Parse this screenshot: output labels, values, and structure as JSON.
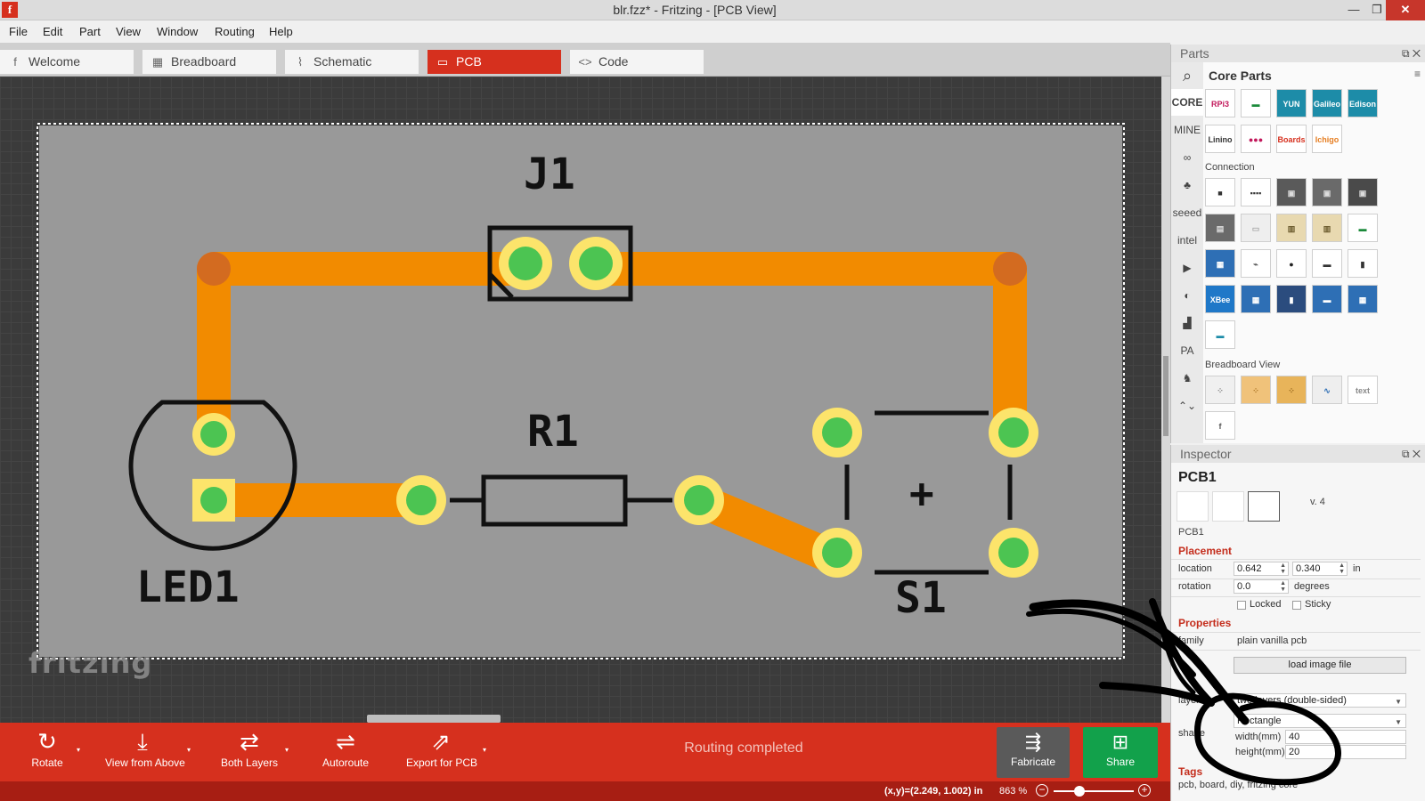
{
  "window": {
    "app_icon": "f",
    "title": "blr.fzz* - Fritzing - [PCB View]",
    "controls": {
      "minimize": "—",
      "maximize": "❐",
      "close": "✕"
    }
  },
  "menu": [
    "File",
    "Edit",
    "Part",
    "View",
    "Window",
    "Routing",
    "Help"
  ],
  "tabs": [
    {
      "label": "Welcome",
      "icon": "f"
    },
    {
      "label": "Breadboard",
      "icon": "▦"
    },
    {
      "label": "Schematic",
      "icon": "⌇"
    },
    {
      "label": "PCB",
      "icon": "▭"
    },
    {
      "label": "Code",
      "icon": "<>"
    }
  ],
  "active_tab": "PCB",
  "pcb": {
    "labels": {
      "j1": "J1",
      "r1": "R1",
      "led1": "LED1",
      "s1": "S1",
      "plus": "+"
    },
    "watermark": "fritzing",
    "colors": {
      "board": "#999999",
      "trace": "#f28b00",
      "pad_ring": "#fce46b",
      "pad_center": "#4cc452",
      "silk": "#111111",
      "canvas": "#3b3b3b"
    }
  },
  "toolbar": {
    "rotate": "Rotate",
    "view_from_above": "View from Above",
    "both_layers": "Both Layers",
    "autoroute": "Autoroute",
    "export_for_pcb": "Export for PCB",
    "status": "Routing completed",
    "fabricate": "Fabricate",
    "share": "Share"
  },
  "statusbar": {
    "coords": "(x,y)=(2.249, 1.002) in",
    "zoom": "863 %",
    "zoom_out": "−",
    "zoom_in": "+"
  },
  "parts": {
    "title": "Parts",
    "panel_buttons": "⧉ ✕",
    "bin_title": "Core Parts",
    "bin_menu": "≡",
    "bins": [
      {
        "label": "CORE",
        "active": true
      },
      {
        "label": "MINE",
        "active": false
      },
      {
        "label": "∞",
        "active": false
      },
      {
        "label": "♣",
        "active": false
      },
      {
        "label": "seeed",
        "active": false
      },
      {
        "label": "intel",
        "active": false
      },
      {
        "label": "▶",
        "active": false
      },
      {
        "label": "◐",
        "active": false
      },
      {
        "label": "▟",
        "active": false
      },
      {
        "label": "PA",
        "active": false
      },
      {
        "label": "♞",
        "active": false
      },
      {
        "label": "⌃⌄",
        "active": false
      }
    ],
    "sections": {
      "connection": "Connection",
      "breadboard_view": "Breadboard View"
    },
    "tiles_row1": [
      {
        "text": "RPi3",
        "bg": "#ffffff",
        "fg": "#c2185b"
      },
      {
        "text": "▬",
        "bg": "#ffffff",
        "fg": "#1b8a3a"
      },
      {
        "text": "YUN",
        "bg": "#1d8ca8",
        "fg": "#ffffff"
      },
      {
        "text": "Galileo",
        "bg": "#1d8ca8",
        "fg": "#ffffff"
      },
      {
        "text": "Edison",
        "bg": "#1d8ca8",
        "fg": "#ffffff"
      }
    ],
    "tiles_row2": [
      {
        "text": "Linino",
        "bg": "#ffffff",
        "fg": "#333333"
      },
      {
        "text": "●●●",
        "bg": "#ffffff",
        "fg": "#c2185b"
      },
      {
        "text": "Boards",
        "bg": "#ffffff",
        "fg": "#d6301e"
      },
      {
        "text": "Ichigo",
        "bg": "#ffffff",
        "fg": "#e67e22"
      }
    ],
    "connection_tiles": [
      {
        "text": "■",
        "bg": "#ffffff",
        "fg": "#333333"
      },
      {
        "text": "▪▪▪▪",
        "bg": "#ffffff",
        "fg": "#333333"
      },
      {
        "text": "▣",
        "bg": "#5a5a5a",
        "fg": "#dddddd"
      },
      {
        "text": "▣",
        "bg": "#6a6a6a",
        "fg": "#dddddd"
      },
      {
        "text": "▣",
        "bg": "#4a4a4a",
        "fg": "#dddddd"
      },
      {
        "text": "▤",
        "bg": "#6a6a6a",
        "fg": "#dddddd"
      },
      {
        "text": "▭",
        "bg": "#eeeeee",
        "fg": "#aaaaaa"
      },
      {
        "text": "▥",
        "bg": "#e8d9b0",
        "fg": "#6b5b2e"
      },
      {
        "text": "▥",
        "bg": "#e8d9b0",
        "fg": "#6b5b2e"
      },
      {
        "text": "▬",
        "bg": "#ffffff",
        "fg": "#1b8a3a"
      },
      {
        "text": "▦",
        "bg": "#2e6fb5",
        "fg": "#ffffff"
      },
      {
        "text": "⌁",
        "bg": "#ffffff",
        "fg": "#555555"
      },
      {
        "text": "●",
        "bg": "#ffffff",
        "fg": "#222222"
      },
      {
        "text": "▬",
        "bg": "#ffffff",
        "fg": "#333333"
      },
      {
        "text": "▮",
        "bg": "#ffffff",
        "fg": "#333333"
      },
      {
        "text": "XBee",
        "bg": "#1f78c8",
        "fg": "#ffffff"
      },
      {
        "text": "▦",
        "bg": "#2e6fb5",
        "fg": "#ffffff"
      },
      {
        "text": "▮",
        "bg": "#2b4c7e",
        "fg": "#ffffff"
      },
      {
        "text": "▬",
        "bg": "#2e6fb5",
        "fg": "#ffffff"
      },
      {
        "text": "▦",
        "bg": "#2e6fb5",
        "fg": "#ffffff"
      },
      {
        "text": "▬",
        "bg": "#ffffff",
        "fg": "#1d8ca8"
      }
    ],
    "breadboard_tiles": [
      {
        "text": "⁘",
        "bg": "#f0f0f0",
        "fg": "#888888"
      },
      {
        "text": "⁘",
        "bg": "#f0c27a",
        "fg": "#b07a2a"
      },
      {
        "text": "⁘",
        "bg": "#e8b45a",
        "fg": "#9a6a1e"
      },
      {
        "text": "∿",
        "bg": "#eeeeee",
        "fg": "#2e6fb5"
      },
      {
        "text": "text",
        "bg": "#ffffff",
        "fg": "#888888"
      },
      {
        "text": "f",
        "bg": "#ffffff",
        "fg": "#555555"
      }
    ]
  },
  "inspector": {
    "title": "Inspector",
    "panel_buttons": "⧉ ✕",
    "name": "PCB1",
    "version": "v. 4",
    "sub_label": "PCB1",
    "placement": {
      "heading": "Placement",
      "location_label": "location",
      "x": "0.642",
      "y": "0.340",
      "unit": "in",
      "rotation_label": "rotation",
      "rotation": "0.0",
      "rotation_unit": "degrees",
      "locked": "Locked",
      "sticky": "Sticky"
    },
    "properties": {
      "heading": "Properties",
      "family_label": "family",
      "family": "plain vanilla pcb",
      "image_select": "",
      "load_image": "load image file",
      "layers_label": "layers",
      "layers": "two layers (double-sided)",
      "shape_label": "shape",
      "shape": "Rectangle",
      "width_label": "width(mm)",
      "width": "40",
      "height_label": "height(mm)",
      "height": "20"
    },
    "tags_heading": "Tags",
    "tags": "pcb, board, diy, fritzing core"
  }
}
